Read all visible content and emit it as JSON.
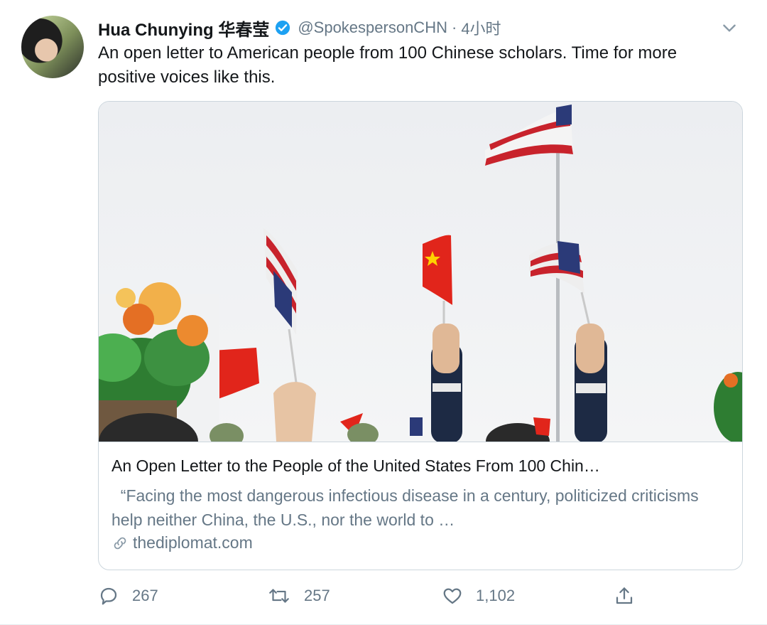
{
  "tweet": {
    "author_name": "Hua Chunying 华春莹",
    "handle": "@SpokespersonCHN",
    "separator": "·",
    "time": "4小时",
    "text": "An open letter to American people from 100 Chinese scholars. Time for more positive voices like this.",
    "card": {
      "title": "An Open Letter to the People of the United States From 100 Chin…",
      "description": "  “Facing the most dangerous infectious disease in a century, politicized criticisms help neither China, the U.S., nor the world to …",
      "domain": "thediplomat.com"
    },
    "actions": {
      "reply_count": "267",
      "retweet_count": "257",
      "like_count": "1,102"
    }
  },
  "colors": {
    "text": "#14171a",
    "secondary": "#657786",
    "verified": "#1da1f2",
    "border": "#ccd6dd"
  },
  "icons": [
    "verified-badge-icon",
    "chevron-down-icon",
    "link-icon",
    "reply-icon",
    "retweet-icon",
    "like-icon",
    "share-icon"
  ]
}
